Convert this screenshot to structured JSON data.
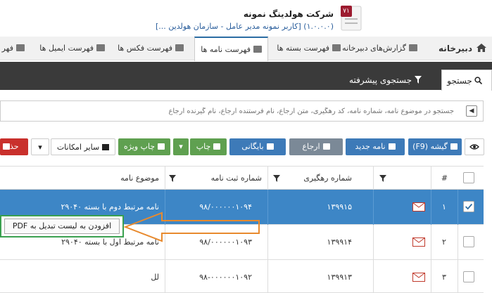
{
  "header": {
    "company_badge": "۷۱",
    "company_name": "شرکت هولدینگ نمونه",
    "user_line": "(۱.۰.۰.۰)   [کاربر نمونه مدیر عامل - سازمان هولدین ...]"
  },
  "nav": {
    "brand": "دبیرخانه",
    "items": [
      {
        "label": "گزارش‌های دبیرخانه"
      },
      {
        "label": "فهرست بسته ها"
      },
      {
        "label": "فهرست نامه ها"
      },
      {
        "label": "فهرست فکس ها"
      },
      {
        "label": "فهرست ایمیل ها"
      },
      {
        "label": "فهر"
      }
    ]
  },
  "search_tabs": {
    "simple": "جستجو",
    "advanced": "جستجوی پیشرفته"
  },
  "search": {
    "placeholder": "جستجو در موضوع نامه، شماره نامه، کد رهگیری، متن ارجاع، نام فرستنده ارجاع، نام گیرنده ارجاع"
  },
  "toolbar": {
    "folder": "گیشه (F9)",
    "new_letter": "نامه جدید",
    "refer": "ارجاع",
    "archive": "بایگانی",
    "print": "چاپ",
    "special_print": "چاپ ویژه",
    "more": "سایر امکانات",
    "delete": "حذ"
  },
  "table": {
    "headers": {
      "num": "#",
      "tracking": "شماره رهگیری",
      "reg_no": "شماره ثبت نامه",
      "subject": "موضوع نامه"
    },
    "rows": [
      {
        "num": "۱",
        "tracking": "۱۳۹۹۱۵",
        "reg_no": "۹۸/۰۰۰۰۰۰۱۰۹۴",
        "subject": "نامه مرتبط دوم با بسته ۲۹۰۴۰",
        "checked": true
      },
      {
        "num": "۲",
        "tracking": "۱۳۹۹۱۴",
        "reg_no": "۹۸/۰۰۰۰۰۰۱۰۹۳",
        "subject": "نامه مرتبط اول با بسته ۲۹۰۴۰",
        "checked": false
      },
      {
        "num": "۳",
        "tracking": "۱۳۹۹۱۳",
        "reg_no": "۹۸-۰۰۰۰۰۰۱۰۹۲",
        "subject": "لل",
        "checked": false
      }
    ]
  },
  "context_popup": {
    "label": "افزودن به لیست تبدیل به PDF"
  },
  "colors": {
    "accent": "#3d7ab8",
    "selected_row": "#3d86c6",
    "popup_border": "#3aa04f",
    "arrow": "#e88a2e",
    "delete": "#c9302c"
  }
}
